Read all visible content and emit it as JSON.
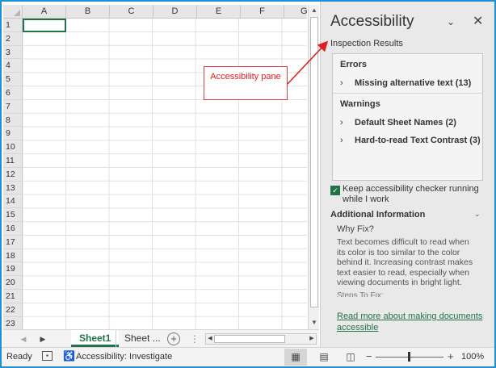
{
  "grid": {
    "columns": [
      "A",
      "B",
      "C",
      "D",
      "E",
      "F",
      "G"
    ],
    "rows": [
      "1",
      "2",
      "3",
      "4",
      "5",
      "6",
      "7",
      "8",
      "9",
      "10",
      "11",
      "12",
      "13",
      "14",
      "15",
      "16",
      "17",
      "18",
      "19",
      "20",
      "21",
      "22",
      "23"
    ]
  },
  "tabs": {
    "sheets": [
      "Sheet1",
      "Sheet ..."
    ],
    "add_symbol": "+",
    "more_symbol": "⋮"
  },
  "pane": {
    "title": "Accessibility",
    "inspection_label": "Inspection Results",
    "errors_heading": "Errors",
    "errors": [
      "Missing alternative text (13)"
    ],
    "warnings_heading": "Warnings",
    "warnings": [
      "Default Sheet Names (2)",
      "Hard-to-read Text Contrast (3)"
    ],
    "keep_running": "Keep accessibility checker running while I work",
    "additional_heading": "Additional Information",
    "why_fix": "Why Fix?",
    "why_text": "Text becomes difficult to read when its color is too similar to the color behind it. Increasing contrast makes text easier to read, especially when viewing documents in bright light.",
    "steps_cut": "Steps To Fix:",
    "more_link": "Read more about making documents accessible"
  },
  "status": {
    "ready": "Ready",
    "accessibility": "Accessibility: Investigate",
    "zoom": "100%"
  },
  "callout": {
    "text": "Accessibility pane"
  },
  "colors": {
    "accent": "#217346",
    "callout": "#e02020",
    "frame": "#1f8fd6"
  }
}
